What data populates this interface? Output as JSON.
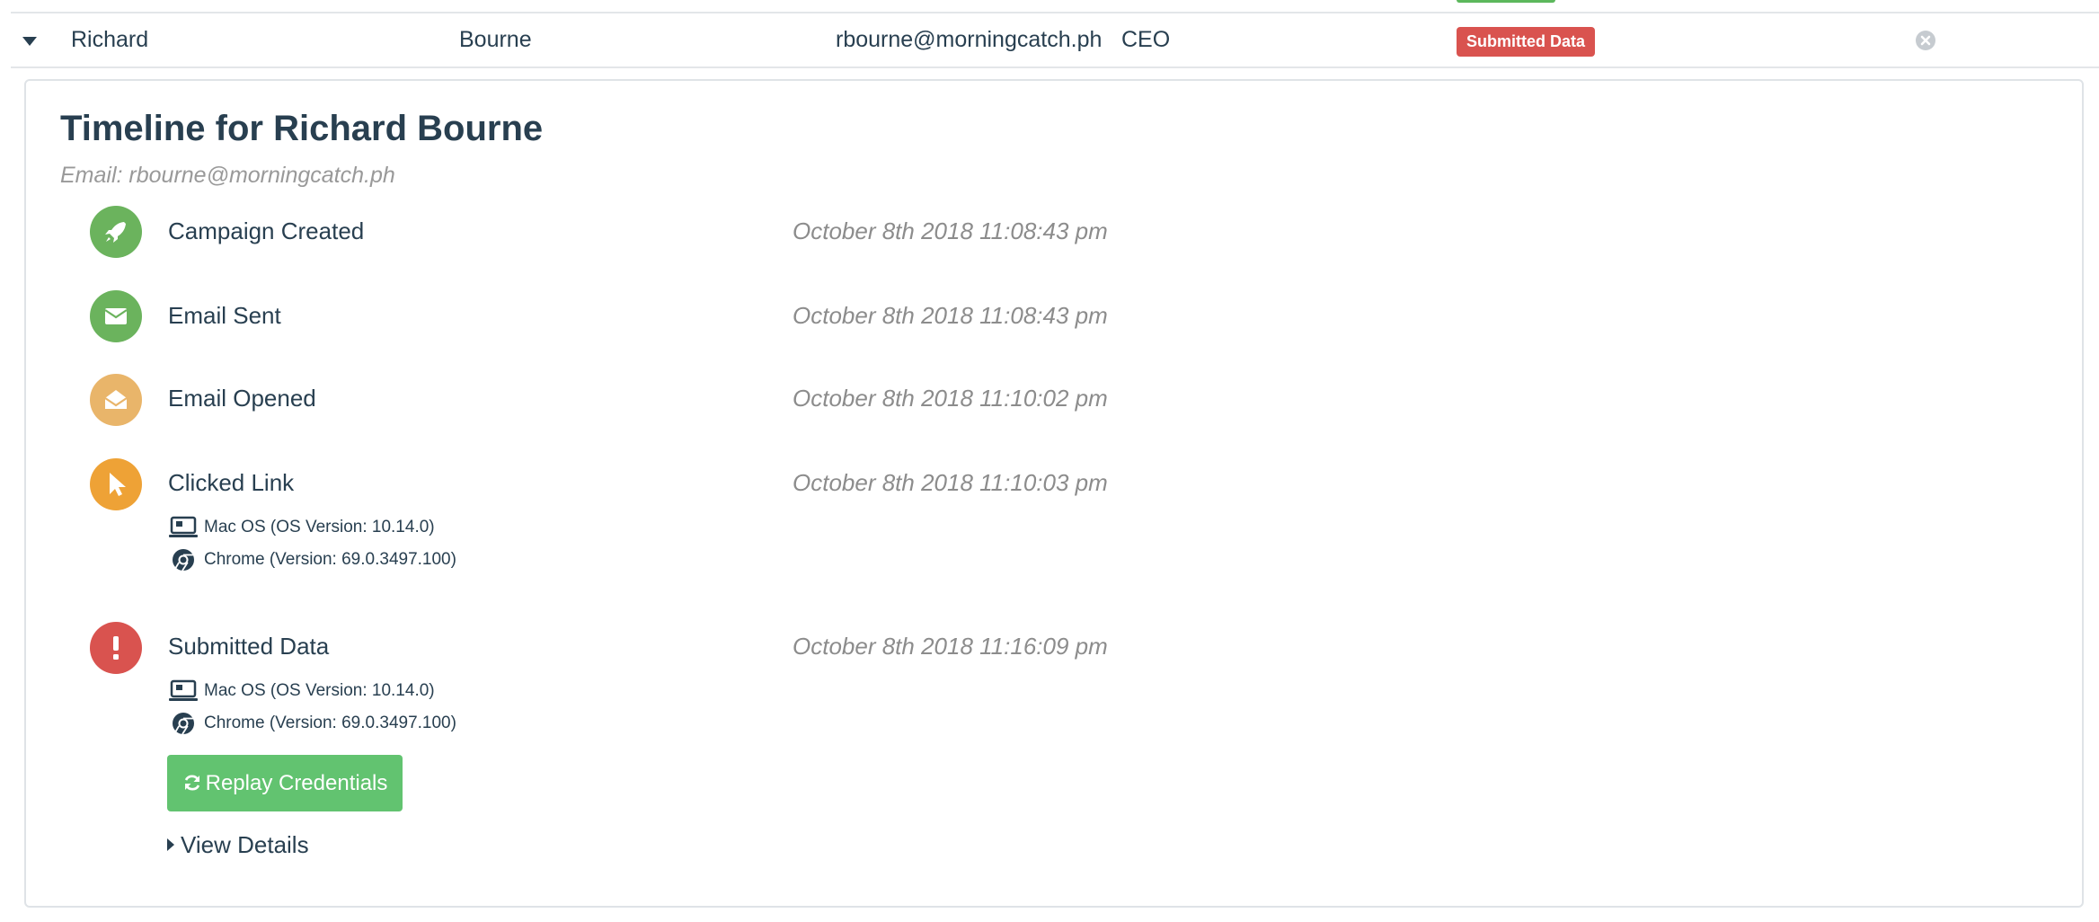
{
  "row": {
    "first_name": "Richard",
    "last_name": "Bourne",
    "email": "rbourne@morningcatch.ph",
    "position": "CEO",
    "status": "Submitted Data"
  },
  "timeline": {
    "title": "Timeline for Richard Bourne",
    "email_line": "Email: rbourne@morningcatch.ph",
    "events": [
      {
        "label": "Campaign Created",
        "time": "October 8th 2018 11:08:43 pm",
        "icon": "rocket-icon",
        "color": "#6bb35d"
      },
      {
        "label": "Email Sent",
        "time": "October 8th 2018 11:08:43 pm",
        "icon": "envelope-icon",
        "color": "#6bb35d"
      },
      {
        "label": "Email Opened",
        "time": "October 8th 2018 11:10:02 pm",
        "icon": "envelope-open-icon",
        "color": "#e9b56a"
      },
      {
        "label": "Clicked Link",
        "time": "October 8th 2018 11:10:03 pm",
        "icon": "mouse-pointer-icon",
        "color": "#eea236"
      },
      {
        "label": "Submitted Data",
        "time": "October 8th 2018 11:16:09 pm",
        "icon": "exclamation-icon",
        "color": "#d9534f"
      }
    ],
    "clicked_details": {
      "os": "Mac OS (OS Version: 10.14.0)",
      "browser": "Chrome (Version: 69.0.3497.100)"
    },
    "submitted_details": {
      "os": "Mac OS (OS Version: 10.14.0)",
      "browser": "Chrome (Version: 69.0.3497.100)"
    },
    "replay_button": "Replay Credentials",
    "view_details": "View Details"
  },
  "colors": {
    "badge_danger": "#d9534f",
    "button_success": "#62c370",
    "text_primary": "#283f50",
    "text_muted": "#999999"
  }
}
